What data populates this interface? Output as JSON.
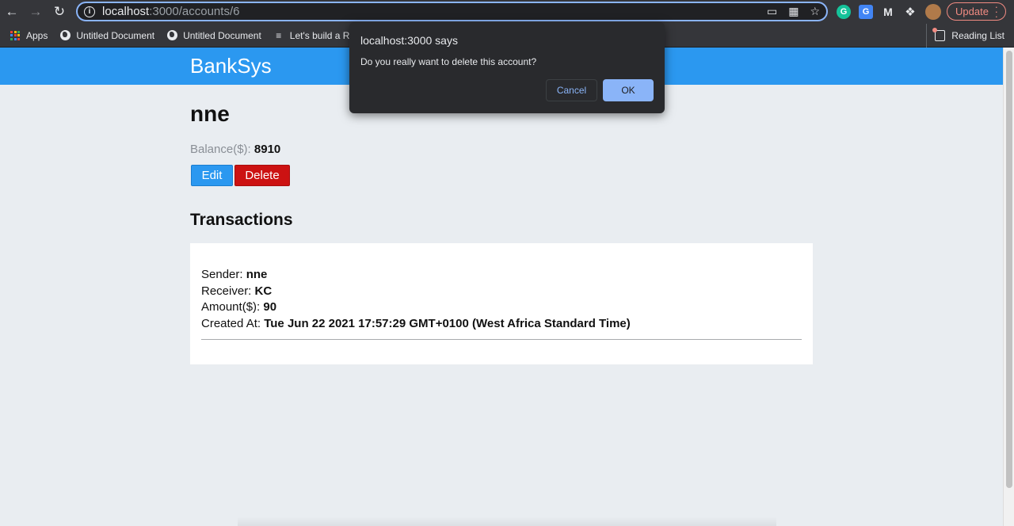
{
  "browser": {
    "url_host": "localhost",
    "url_path": ":3000/accounts/6",
    "update_label": "Update",
    "bookmarks": [
      "Apps",
      "Untitled Document",
      "Untitled Document",
      "Let's build a Rea"
    ],
    "reading_list": "Reading List"
  },
  "app": {
    "brand": "BankSys",
    "account_name": "nne",
    "balance_label": "Balance($):",
    "balance_value": "8910",
    "edit_label": "Edit",
    "delete_label": "Delete",
    "transactions_title": "Transactions",
    "transaction": {
      "sender_label": "Sender:",
      "sender": "nne",
      "receiver_label": "Receiver:",
      "receiver": "KC",
      "amount_label": "Amount($):",
      "amount": "90",
      "created_label": "Created At:",
      "created": "Tue Jun 22 2021 17:57:29 GMT+0100 (West Africa Standard Time)"
    }
  },
  "dialog": {
    "title": "localhost:3000 says",
    "message": "Do you really want to delete this account?",
    "cancel_label": "Cancel",
    "ok_label": "OK"
  },
  "colors": {
    "navbar": "#2b98f0",
    "delete": "#cc1212",
    "dialog_bg": "#292a2d",
    "ok_button": "#8ab4f8"
  }
}
